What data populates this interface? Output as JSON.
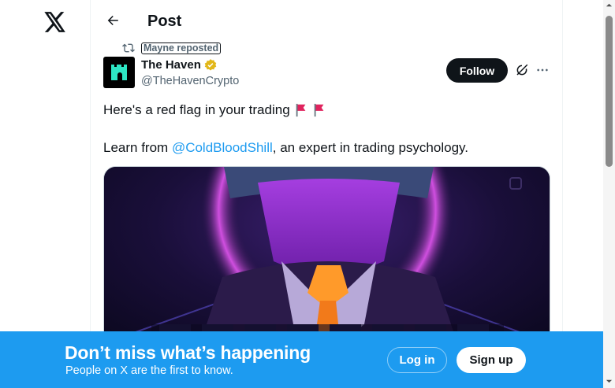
{
  "header": {
    "title": "Post"
  },
  "repost": {
    "label": "Mayne reposted"
  },
  "author": {
    "name": "The Haven",
    "handle": "@TheHavenCrypto"
  },
  "actions": {
    "follow_label": "Follow"
  },
  "tweet": {
    "line1": "Here's a red flag in your trading",
    "line2_prefix": "Learn from ",
    "mention": "@ColdBloodShill",
    "line2_suffix": ", an expert in trading psychology."
  },
  "banner": {
    "heading": "Don’t miss what’s happening",
    "subtext": "People on X are the first to know.",
    "login_label": "Log in",
    "signup_label": "Sign up"
  },
  "colors": {
    "accent": "#1d9bf0",
    "text": "#0f1419",
    "muted": "#536471",
    "verified": "#e2b719",
    "flag": "#e0245e"
  },
  "icons": {
    "logo": "x-logo-icon",
    "back": "arrow-left-icon",
    "repost": "repost-icon",
    "verified": "verified-badge-icon",
    "grok": "grok-icon",
    "more": "more-icon",
    "flag": "red-flag-emoji"
  }
}
